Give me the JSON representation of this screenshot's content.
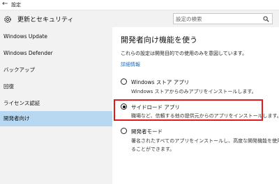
{
  "window": {
    "title": "設定"
  },
  "header": {
    "title": "更新とセキュリティ"
  },
  "search": {
    "placeholder": "設定の検索"
  },
  "sidebar": {
    "items": [
      {
        "label": "Windows Update"
      },
      {
        "label": "Windows Defender"
      },
      {
        "label": "バックアップ"
      },
      {
        "label": "回復"
      },
      {
        "label": "ライセンス認証"
      },
      {
        "label": "開発者向け"
      }
    ],
    "active_index": 5
  },
  "main": {
    "title": "開発者向け機能を使う",
    "description": "これらの設定は開発目的での使用のみを意図しています。",
    "link": "詳細情報",
    "options": [
      {
        "label": "Windows ストア アプリ",
        "description": [
          "Windows ストアからのみアプリをインストールします。"
        ],
        "selected": false
      },
      {
        "label": "サイドロード アプリ",
        "description": [
          "職場など、信頼する他の提供元からのアプリをインストールします。"
        ],
        "selected": true
      },
      {
        "label": "開発者モード",
        "description": [
          "署名されたすべてのアプリをインストールし、高度な開発機能を使用す",
          "ることができます。"
        ],
        "selected": false
      }
    ]
  },
  "colors": {
    "highlight_border": "#e0191c",
    "active_nav": "#b7d8f0",
    "link": "#1f6bb3"
  }
}
